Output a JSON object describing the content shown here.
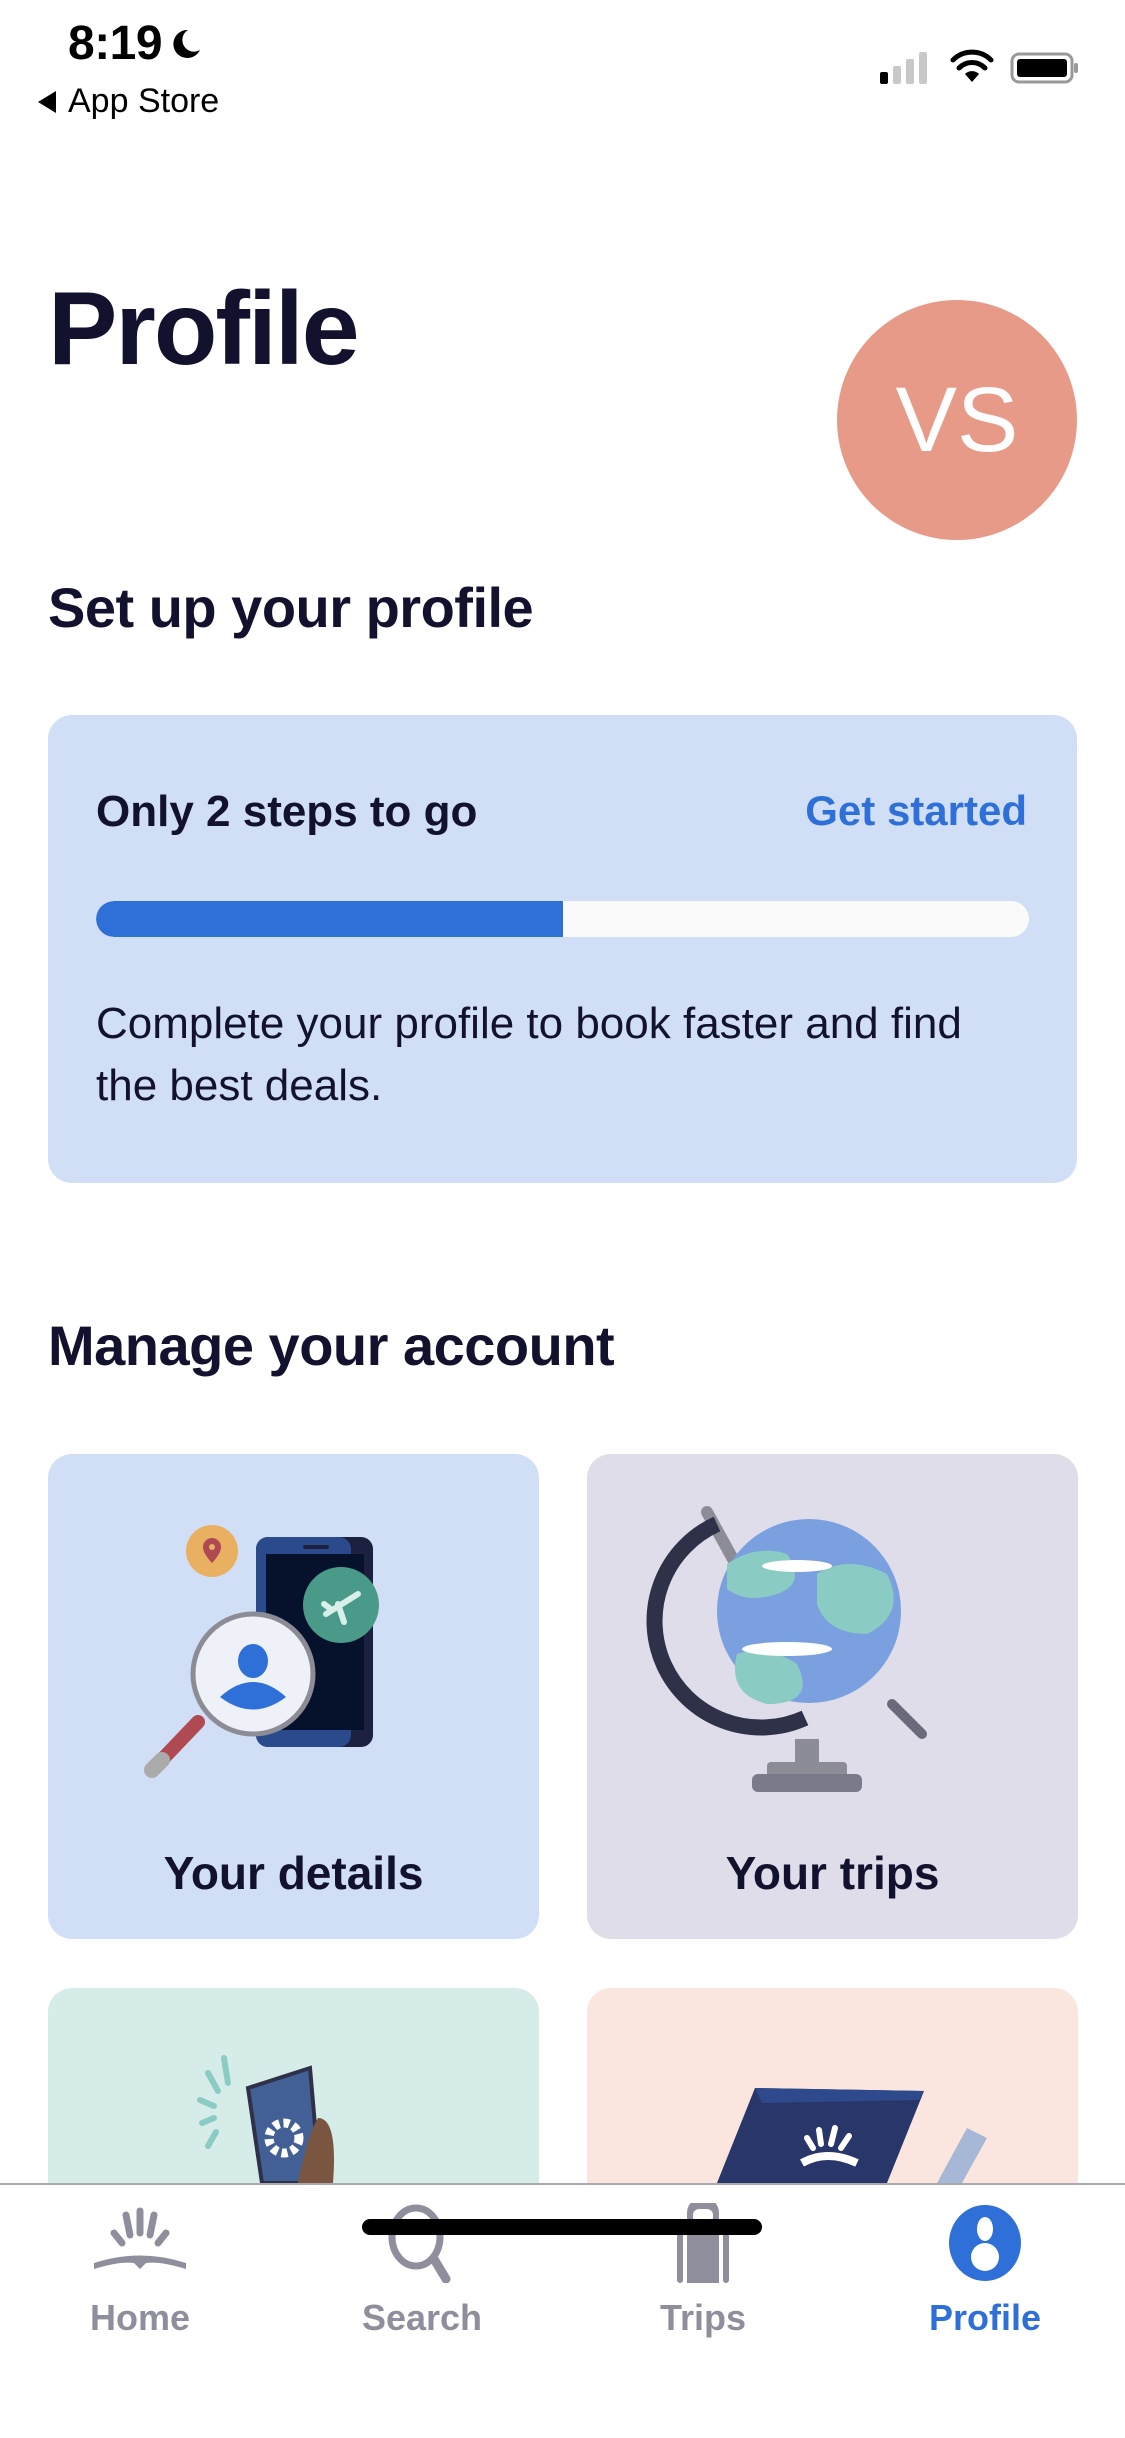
{
  "status_bar": {
    "time": "8:19",
    "focus_icon": "moon-icon",
    "back_label": "App Store",
    "signal_icon": "cellular-signal-icon",
    "wifi_icon": "wifi-icon",
    "battery_icon": "battery-icon"
  },
  "header": {
    "title": "Profile",
    "avatar_initials": "VS",
    "avatar_color": "#E89A88"
  },
  "setup": {
    "section_title": "Set up your profile",
    "heading": "Only 2 steps to go",
    "action_label": "Get started",
    "progress_percent": 50,
    "description": "Complete your profile to book faster and find the best deals."
  },
  "account": {
    "section_title": "Manage your account",
    "tiles": [
      {
        "label": "Your details",
        "icon": "profile-search-illustration",
        "bg": "#D0DFF5"
      },
      {
        "label": "Your trips",
        "icon": "globe-illustration",
        "bg": "#DEDDEA"
      },
      {
        "label": "",
        "icon": "phone-settings-illustration",
        "bg": "#D6ECE9"
      },
      {
        "label": "",
        "icon": "passport-book-illustration",
        "bg": "#FAE6DF"
      }
    ]
  },
  "tabbar": {
    "accent": "#2F6FD8",
    "inactive": "#8E8E9C",
    "items": [
      {
        "label": "Home",
        "icon": "sunrise-home-icon",
        "active": false
      },
      {
        "label": "Search",
        "icon": "search-icon",
        "active": false
      },
      {
        "label": "Trips",
        "icon": "luggage-icon",
        "active": false
      },
      {
        "label": "Profile",
        "icon": "profile-icon",
        "active": true
      }
    ]
  }
}
